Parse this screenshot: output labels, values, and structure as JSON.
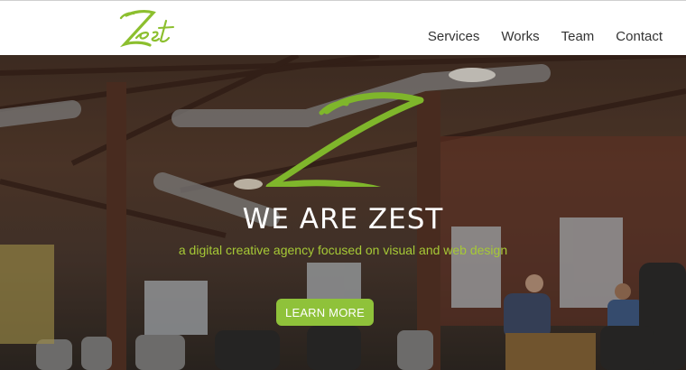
{
  "colors": {
    "accent": "#8fc23a",
    "tagline": "#a6c936",
    "nav_text": "#333333",
    "hero_text": "#ffffff"
  },
  "brand": {
    "logo_text": "Zest"
  },
  "nav": {
    "items": [
      {
        "label": "Services"
      },
      {
        "label": "Works"
      },
      {
        "label": "Team"
      },
      {
        "label": "Contact"
      }
    ]
  },
  "hero": {
    "title": "WE ARE ZEST",
    "tagline": "a digital creative agency focused on visual and web design",
    "cta_label": "LEARN MORE",
    "background": "office-interior-photo"
  }
}
